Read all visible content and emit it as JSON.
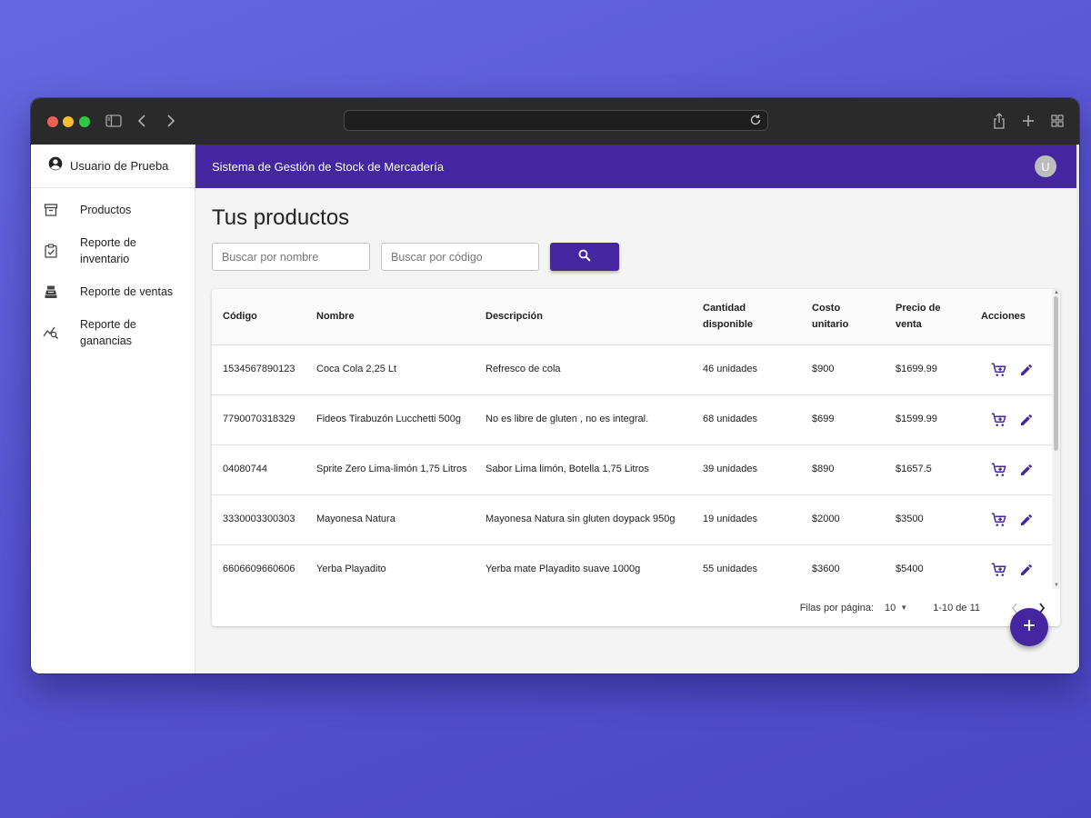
{
  "browser": {
    "icons": [
      "sidebar-toggle-icon",
      "back-arrow-icon",
      "forward-arrow-icon",
      "reload-icon",
      "share-icon",
      "new-tab-plus-icon",
      "tab-grid-icon"
    ],
    "url": ""
  },
  "sidebar": {
    "user_name": "Usuario de Prueba",
    "items": [
      {
        "label": "Productos",
        "icon": "archive-box-icon"
      },
      {
        "label": "Reporte de inventario",
        "icon": "clipboard-check-icon"
      },
      {
        "label": "Reporte de ventas",
        "icon": "cash-register-icon"
      },
      {
        "label": "Reporte de ganancias",
        "icon": "chart-search-icon"
      }
    ]
  },
  "appbar": {
    "title": "Sistema de Gestión de Stock de Mercadería",
    "avatar_letter": "U"
  },
  "main": {
    "page_title": "Tus productos",
    "search_name_placeholder": "Buscar por nombre",
    "search_code_placeholder": "Buscar por código",
    "search_button_icon": "magnifier-icon"
  },
  "table": {
    "columns": [
      "Código",
      "Nombre",
      "Descripción",
      "Cantidad disponible",
      "Costo unitario",
      "Precio de venta",
      "Acciones"
    ],
    "rows": [
      {
        "codigo": "1534567890123",
        "nombre": "Coca Cola 2,25 Lt",
        "descripcion": "Refresco de cola",
        "cantidad": "46 unidades",
        "costo": "$900",
        "precio": "$1699.99"
      },
      {
        "codigo": "7790070318329",
        "nombre": "Fideos Tirabuzón Lucchetti 500g",
        "descripcion": "No es libre de gluten , no es integral.",
        "cantidad": "68 unidades",
        "costo": "$699",
        "precio": "$1599.99"
      },
      {
        "codigo": "04080744",
        "nombre": "Sprite Zero Lima-limón 1,75 Litros",
        "descripcion": "Sabor Lima limón, Botella 1,75 Litros",
        "cantidad": "39 unidades",
        "costo": "$890",
        "precio": "$1657.5"
      },
      {
        "codigo": "3330003300303",
        "nombre": "Mayonesa Natura",
        "descripcion": "Mayonesa Natura sin gluten doypack 950g",
        "cantidad": "19 unidades",
        "costo": "$2000",
        "precio": "$3500"
      },
      {
        "codigo": "6606609660606",
        "nombre": "Yerba Playadito",
        "descripcion": "Yerba mate Playadito suave 1000g",
        "cantidad": "55 unidades",
        "costo": "$3600",
        "precio": "$5400"
      }
    ],
    "row_action_icons": [
      "add-to-cart-icon",
      "edit-pencil-icon"
    ]
  },
  "pagination": {
    "rows_per_page_label": "Filas por página:",
    "rows_per_page_value": "10",
    "range_label": "1-10 de 11"
  },
  "colors": {
    "primary": "#4526a1",
    "background_gradient_start": "#6468e0",
    "background_gradient_end": "#4a47c3",
    "content_bg": "#f4f4f4"
  }
}
